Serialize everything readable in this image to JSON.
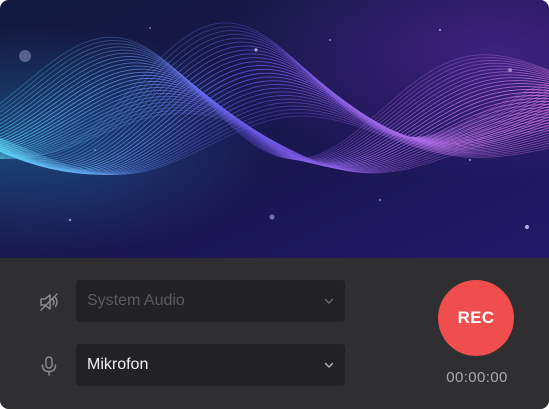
{
  "colors": {
    "banner_top": "#141438",
    "banner_bottom": "#1c1660",
    "panel": "#2f2f31",
    "select_bg": "#222224",
    "rec": "#f04e4e",
    "wave_left": "#5ad2f0",
    "wave_mid": "#6a56e8",
    "wave_right": "#d07ae8"
  },
  "banner": {
    "image": "sound-wave-illustration"
  },
  "audio_sources": {
    "system_audio": {
      "icon": "speaker-muted-icon",
      "label": "System Audio",
      "enabled": false
    },
    "microphone": {
      "icon": "microphone-icon",
      "label": "Mikrofon",
      "enabled": true
    }
  },
  "recording": {
    "button_label": "REC",
    "timer": "00:00:00"
  }
}
